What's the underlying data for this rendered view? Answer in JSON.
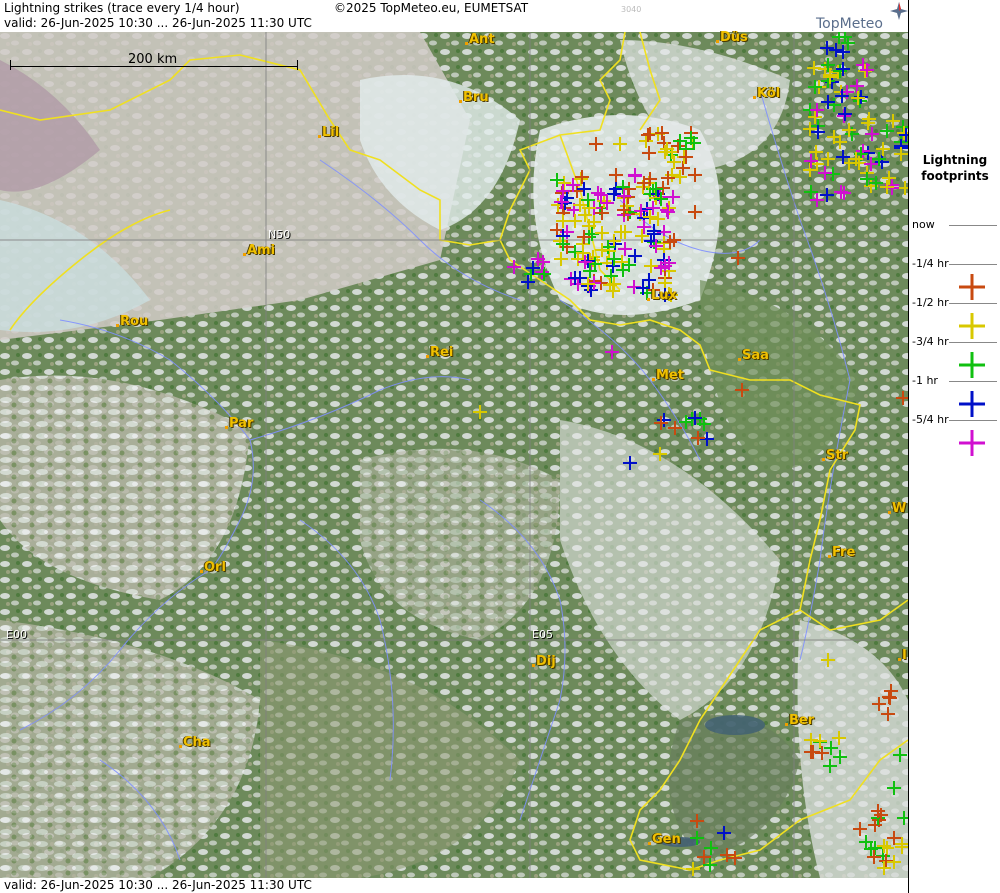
{
  "header": {
    "title": "Lightning strikes (trace every 1/4 hour)",
    "copyright": "©2025 TopMeteo.eu, EUMETSAT",
    "valid": "valid:  26-Jun-2025 10:30 ... 26-Jun-2025 11:30 UTC",
    "image_number": "3040",
    "brand": "TopMeteo"
  },
  "footer": {
    "valid": "valid:  26-Jun-2025 10:30 ... 26-Jun-2025 11:30 UTC"
  },
  "scale": {
    "label": "200 km"
  },
  "grid_labels": {
    "lat_n50": "N50",
    "lon_e00": "E00",
    "lon_e05": "E05"
  },
  "cities": [
    "Ant",
    "Düs",
    "Bru",
    "Köl",
    "Lil",
    "Ami",
    "Rou",
    "Lux",
    "Rei",
    "Saa",
    "Met",
    "Par",
    "Str",
    "W",
    "Fre",
    "Orl",
    "Dij",
    "Ber",
    "Cha",
    "Gen",
    "I"
  ],
  "legend": {
    "title": "Lightning footprints",
    "rows": [
      {
        "label": "now",
        "color": ""
      },
      {
        "label": "-1/4 hr",
        "color": "#c84a10"
      },
      {
        "label": "-1/2 hr",
        "color": "#d8c800"
      },
      {
        "label": "-3/4 hr",
        "color": "#10c010"
      },
      {
        "label": "-1 hr",
        "color": "#0010c8"
      },
      {
        "label": "-5/4 hr",
        "color": "#d010d0"
      }
    ]
  },
  "colors": {
    "age_15min": "#c84a10",
    "age_30min": "#d8c800",
    "age_45min": "#10c010",
    "age_60min": "#0010c8",
    "age_75min": "#d010d0",
    "borders": "#f0e020",
    "rivers": "#8090ff",
    "grid": "#808080"
  }
}
